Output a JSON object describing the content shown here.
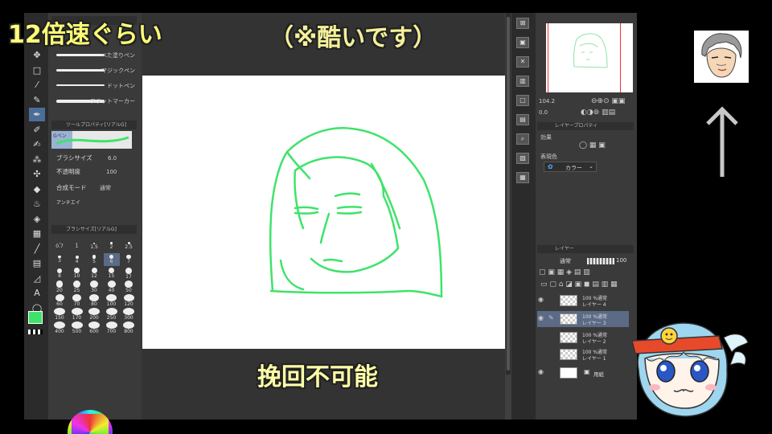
{
  "captions": {
    "top_left": "12倍速ぐらい",
    "top_center": "（※酷いです）",
    "bottom_center": "挽回不可能"
  },
  "brush_list": [
    {
      "name": "べた塗りペン"
    },
    {
      "name": "マジックペン"
    },
    {
      "name": "ドットペン"
    },
    {
      "name": "フラットマーカー"
    }
  ],
  "tool_property": {
    "title": "ツールプロパティ[リアルG]",
    "preview_label": "Gペン",
    "brush_size_label": "ブラシサイズ",
    "brush_size_value": "6.0",
    "opacity_label": "不透明度",
    "opacity_value": "100",
    "blend_mode_label": "合成モード",
    "blend_mode_value": "通常",
    "antialias_label": "アンチエイ"
  },
  "brush_size_panel": {
    "title": "ブラシサイズ[リアルG]",
    "sizes": [
      "0.7",
      "1",
      "1.5",
      "2",
      "2.5",
      "3",
      "4",
      "5",
      "6",
      "7",
      "8",
      "10",
      "12",
      "15",
      "17",
      "20",
      "25",
      "30",
      "40",
      "50",
      "60",
      "70",
      "80",
      "100",
      "120",
      "150",
      "170",
      "200",
      "250",
      "300",
      "400",
      "500",
      "600",
      "700",
      "800"
    ],
    "selected": "6"
  },
  "navigator": {
    "zoom_value": "104.2",
    "angle_value": "0.0"
  },
  "layer_property": {
    "title": "レイヤープロパティ",
    "effect_label": "効果",
    "expression_color_label": "表現色",
    "expression_color_value": "カラー"
  },
  "layer_panel": {
    "title": "レイヤー",
    "blend_mode": "通常",
    "opacity": "100",
    "layers": [
      {
        "line1": "100 %通常",
        "line2": "レイヤー 4",
        "selected": false
      },
      {
        "line1": "100 %通常",
        "line2": "レイヤー 3",
        "selected": true
      },
      {
        "line1": "100 %通常",
        "line2": "レイヤー 2",
        "selected": false
      },
      {
        "line1": "100 %通常",
        "line2": "レイヤー 1",
        "selected": false
      },
      {
        "line1": "",
        "line2": "用紙",
        "selected": false
      }
    ]
  },
  "colors": {
    "drawing_color": "#3fe36b",
    "caption_yellow": "#ffff77",
    "selection_blue": "#5b6a85"
  }
}
